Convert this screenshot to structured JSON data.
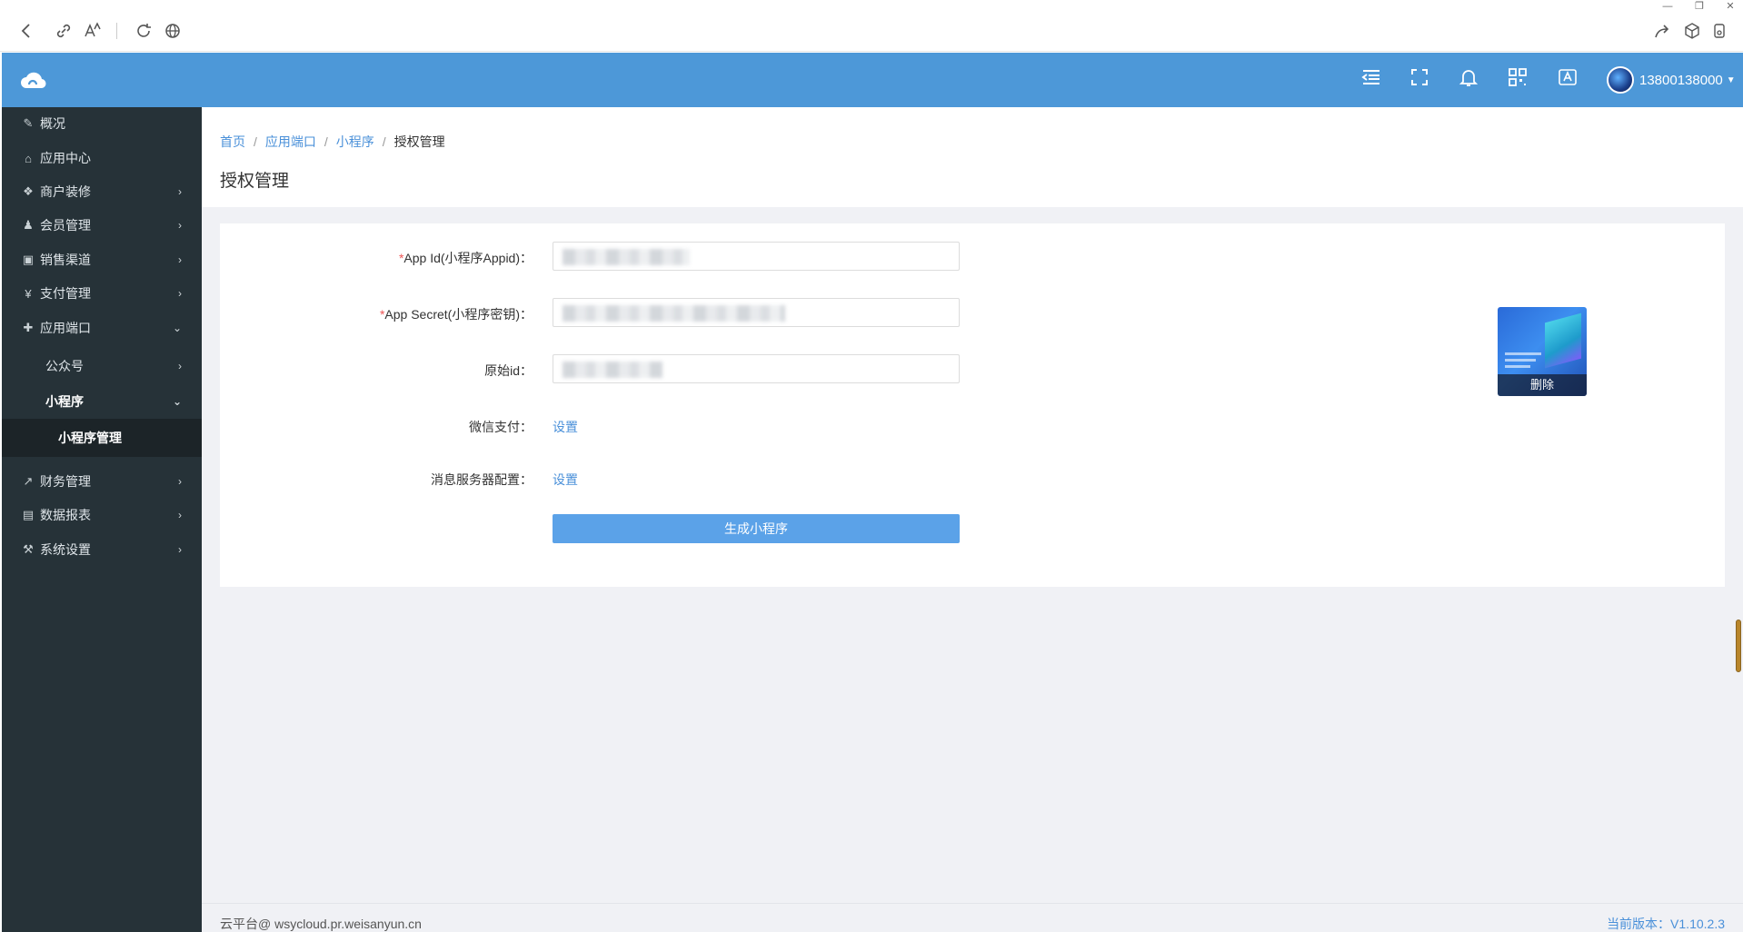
{
  "header": {
    "username": "13800138000"
  },
  "sidebar": {
    "items": [
      {
        "label": "概况",
        "icon": "edit-icon"
      },
      {
        "label": "应用中心",
        "icon": "home-icon"
      },
      {
        "label": "商户装修",
        "icon": "cubes-icon"
      },
      {
        "label": "会员管理",
        "icon": "users-icon"
      },
      {
        "label": "销售渠道",
        "icon": "money-icon"
      },
      {
        "label": "支付管理",
        "icon": "yen-icon"
      },
      {
        "label": "应用端口",
        "icon": "puzzle-icon"
      },
      {
        "label": "公众号"
      },
      {
        "label": "小程序"
      },
      {
        "label": "小程序管理"
      },
      {
        "label": "财务管理",
        "icon": "line-chart-icon"
      },
      {
        "label": "数据报表",
        "icon": "report-icon"
      },
      {
        "label": "系统设置",
        "icon": "gavel-icon"
      }
    ]
  },
  "breadcrumb": {
    "items": [
      "首页",
      "应用端口",
      "小程序"
    ],
    "current": "授权管理"
  },
  "page": {
    "title": "授权管理"
  },
  "form": {
    "required_mark": "*",
    "appid_label": "App Id(小程序Appid)：",
    "secret_label": "App Secret(小程序密钥)：",
    "origin_label": "原始id：",
    "wxpay_label": "微信支付：",
    "msgserver_label": "消息服务器配置：",
    "wxpay_link": "设置",
    "msgserver_link": "设置",
    "submit": "生成小程序"
  },
  "thumbnail": {
    "delete_label": "删除"
  },
  "footer": {
    "copyright": "云平台@ wsycloud.pr.weisanyun.cn",
    "version": "当前版本：V1.10.2.3"
  },
  "colors": {
    "header": "#4d98d8",
    "sidebar": "#263238",
    "accent": "#4a90d9",
    "button": "#5ba2e8"
  }
}
